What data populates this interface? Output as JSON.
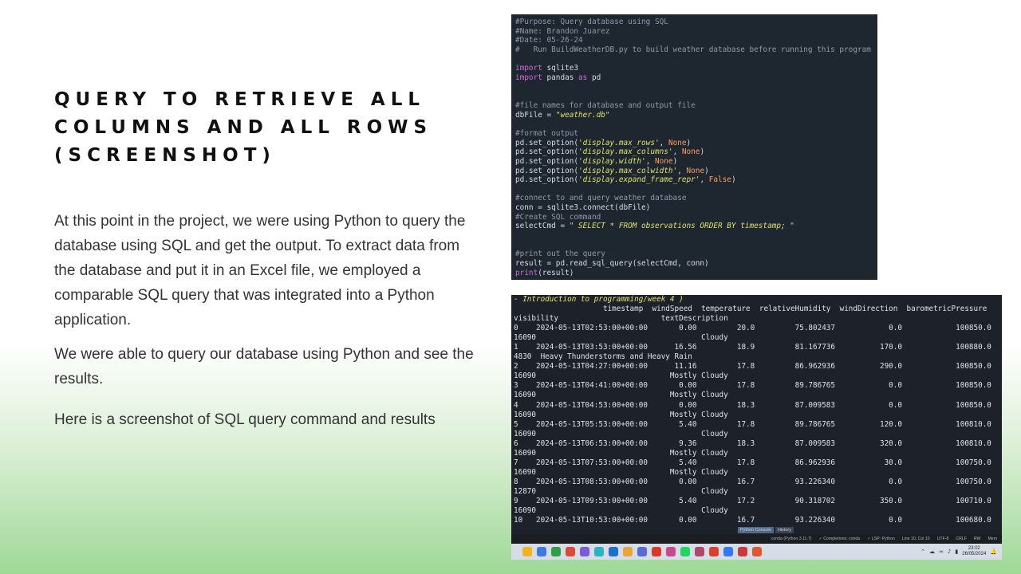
{
  "slide": {
    "title_lines": [
      "QUERY TO RETRIEVE ALL",
      "COLUMNS AND ALL ROWS",
      "(SCREENSHOT)"
    ],
    "paragraphs": [
      "At this point in the project, we were using Python to query the database using SQL and get the output. To extract data from the database and put it in an Excel file, we employed a comparable SQL query that was integrated into a Python application.",
      " We were able to query our database using Python and see the results.",
      "Here is a screenshot of SQL query command and results"
    ]
  },
  "code": {
    "header_comments": [
      "#Purpose: Query database using SQL",
      "#Name: Brandon Juarez",
      "#Date: 05-26-24",
      "#   Run BuildWeatherDB.py to build weather database before running this program"
    ],
    "import_kw": "import",
    "import_1": " sqlite3",
    "import_2_mod": " pandas ",
    "import_as": "as",
    "import_2_alias": " pd",
    "comment_files": "#file names for database and output file",
    "dbfile_prefix": "dbFile = ",
    "dbfile_value": "\"weather.db\"",
    "comment_format": "#format output",
    "set_options": [
      {
        "prefix": "pd.set_option(",
        "key": "'display.max_rows'",
        "sep": ", ",
        "val": "None",
        "suffix": ")"
      },
      {
        "prefix": "pd.set_option(",
        "key": "'display.max_columns'",
        "sep": ", ",
        "val": "None",
        "suffix": ")"
      },
      {
        "prefix": "pd.set_option(",
        "key": "'display.width'",
        "sep": ", ",
        "val": "None",
        "suffix": ")"
      },
      {
        "prefix": "pd.set_option(",
        "key": "'display.max_colwidth'",
        "sep": ", ",
        "val": "None",
        "suffix": ")"
      },
      {
        "prefix": "pd.set_option(",
        "key": "'display.expand_frame_repr'",
        "sep": ", ",
        "val": "False",
        "suffix": ")"
      }
    ],
    "comment_connect": "#connect to and query weather database",
    "conn_line": "conn = sqlite3.connect(dbFile)",
    "comment_create": "#Create SQL command",
    "select_prefix": "selectCmd = ",
    "select_value": "\" SELECT * FROM observations ORDER BY timestamp; \"",
    "comment_print": "#print out the query",
    "result_line": "result = pd.read_sql_query(selectCmd, conn)",
    "print_kw": "print",
    "print_rest": "(result)"
  },
  "output": {
    "top_line": "- Introduction to programming/week 4 )",
    "header_1": "                    timestamp  windSpeed  temperature  relativeHumidity  windDirection  barometricPressure",
    "header_2": "visibility                       textDescription",
    "rows": [
      {
        "a": "0    2024-05-13T02:53:00+00:00       0.00         20.0         75.802437            0.0            100850.0",
        "b": "16090                                     Cloudy"
      },
      {
        "a": "1    2024-05-13T03:53:00+00:00      16.56         18.9         81.167736          170.0            100880.0",
        "b": "4830  Heavy Thunderstorms and Heavy Rain"
      },
      {
        "a": "2    2024-05-13T04:27:00+00:00      11.16         17.8         86.962936          290.0            100850.0",
        "b": "16090                              Mostly Cloudy"
      },
      {
        "a": "3    2024-05-13T04:41:00+00:00       0.00         17.8         89.786765            0.0            100850.0",
        "b": "16090                              Mostly Cloudy"
      },
      {
        "a": "4    2024-05-13T04:53:00+00:00       0.00         18.3         87.009583            0.0            100850.0",
        "b": "16090                              Mostly Cloudy"
      },
      {
        "a": "5    2024-05-13T05:53:00+00:00       5.40         17.8         89.786765          120.0            100810.0",
        "b": "16090                                     Cloudy"
      },
      {
        "a": "6    2024-05-13T06:53:00+00:00       9.36         18.3         87.009583          320.0            100810.0",
        "b": "16090                              Mostly Cloudy"
      },
      {
        "a": "7    2024-05-13T07:53:00+00:00       5.40         17.8         86.962936           30.0            100750.0",
        "b": "16090                              Mostly Cloudy"
      },
      {
        "a": "8    2024-05-13T08:53:00+00:00       0.00         16.7         93.226340            0.0            100750.0",
        "b": "12870                                     Cloudy"
      },
      {
        "a": "9    2024-05-13T09:53:00+00:00       5.40         17.2         90.318702          350.0            100710.0",
        "b": "16090                                     Cloudy"
      },
      {
        "a": "10   2024-05-13T10:53:00+00:00       0.00         16.7         93.226340            0.0            100680.0",
        "b": ""
      }
    ],
    "tabs": [
      "Python Console",
      "History"
    ],
    "status_items": [
      "conda (Python 3.11.7)",
      "✓ Completions: conda",
      "✓ LSP: Python",
      "Line 10, Col 10",
      "UTF-8",
      "CRLF",
      "RW",
      "Mem"
    ]
  },
  "taskbar": {
    "icon_colors": [
      "#f2b31b",
      "#3d7be0",
      "#2f9e44",
      "#e0483a",
      "#7b5cd6",
      "#2bb3c4",
      "#1f6fcf",
      "#e8a53a",
      "#5b6bd4",
      "#d83b2a",
      "#c94a8a",
      "#1ed760",
      "#b0486a",
      "#d9412e",
      "#3478f6",
      "#c63b3b",
      "#e0582d"
    ],
    "time": "23:02",
    "date": "26/05/2024"
  }
}
